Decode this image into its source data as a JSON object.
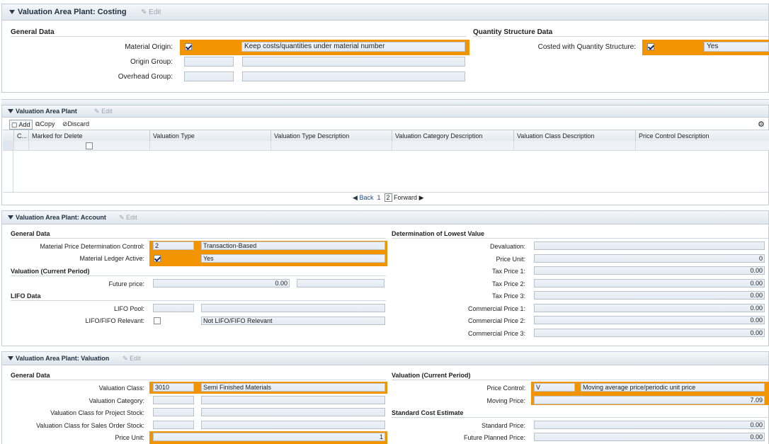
{
  "costing": {
    "title": "Valuation Area Plant: Costing",
    "edit": "Edit",
    "general_data": "General Data",
    "material_origin_label": "Material Origin:",
    "material_origin_text": "Keep costs/quantities under material number",
    "origin_group_label": "Origin Group:",
    "overhead_group_label": "Overhead Group:",
    "qs_title": "Quantity Structure Data",
    "costed_qs_label": "Costed with Quantity Structure:",
    "costed_qs_value": "Yes",
    "material_origin_checked": true,
    "costed_qs_checked": true
  },
  "collapsed": {
    "title": "Valuation Area Plant",
    "edit": "Edit"
  },
  "vap": {
    "title": "Valuation Area Plant",
    "edit": "Edit",
    "toolbar": {
      "add": "Add",
      "copy": "Copy",
      "discard": "Discard"
    },
    "columns": [
      "C...",
      "Marked for Delete",
      "Valuation Type",
      "Valuation Type Description",
      "Valuation Category Description",
      "Valuation Class Description",
      "Price Control Description"
    ],
    "pager": {
      "back": "Back",
      "page1": "1",
      "page2": "2",
      "forward": "Forward"
    }
  },
  "account": {
    "title": "Valuation Area Plant: Account",
    "edit": "Edit",
    "general_data": "General Data",
    "mpdc_label": "Material Price Determination Control:",
    "mpdc_code": "2",
    "mpdc_text": "Transaction-Based",
    "mla_label": "Material Ledger Active:",
    "mla_text": "Yes",
    "valuation_current": "Valuation (Current Period)",
    "future_price_label": "Future price:",
    "future_price_value": "0.00",
    "lifo_data": "LIFO Data",
    "lifo_pool_label": "LIFO Pool:",
    "lifo_rel_label": "LIFO/FIFO Relevant:",
    "lifo_rel_text": "Not LIFO/FIFO Relevant",
    "lowest_title": "Determination of Lowest Value",
    "devaluation_label": "Devaluation:",
    "price_unit_label": "Price Unit:",
    "price_unit_value": "0",
    "tax1_label": "Tax Price 1:",
    "tax1_value": "0.00",
    "tax2_label": "Tax Price 2:",
    "tax2_value": "0.00",
    "tax3_label": "Tax Price 3:",
    "tax3_value": "0.00",
    "com1_label": "Commercial Price 1:",
    "com1_value": "0.00",
    "com2_label": "Commercial Price 2:",
    "com2_value": "0.00",
    "com3_label": "Commercial Price 3:",
    "com3_value": "0.00"
  },
  "valuation": {
    "title": "Valuation Area Plant: Valuation",
    "edit": "Edit",
    "general_data": "General Data",
    "vclass_label": "Valuation Class:",
    "vclass_code": "3010",
    "vclass_text": "Semi Finished Materials",
    "vcat_label": "Valuation Category:",
    "vc_proj_label": "Valuation Class for Project Stock:",
    "vc_so_label": "Valuation Class for Sales Order Stock:",
    "price_unit_label": "Price Unit:",
    "price_unit_value": "1",
    "current_title": "Valuation (Current Period)",
    "price_control_label": "Price Control:",
    "price_control_code": "V",
    "price_control_text": "Moving average price/periodic unit price",
    "moving_price_label": "Moving Price:",
    "moving_price_value": "7.09",
    "std_cost_title": "Standard Cost Estimate",
    "std_price_label": "Standard Price:",
    "std_price_value": "0.00",
    "fpp_label": "Future Planned Price:",
    "fpp_value": "0.00"
  },
  "colors": {
    "highlight": "#f29300",
    "header": "#dfe6ed",
    "link": "#1a4a8a"
  }
}
